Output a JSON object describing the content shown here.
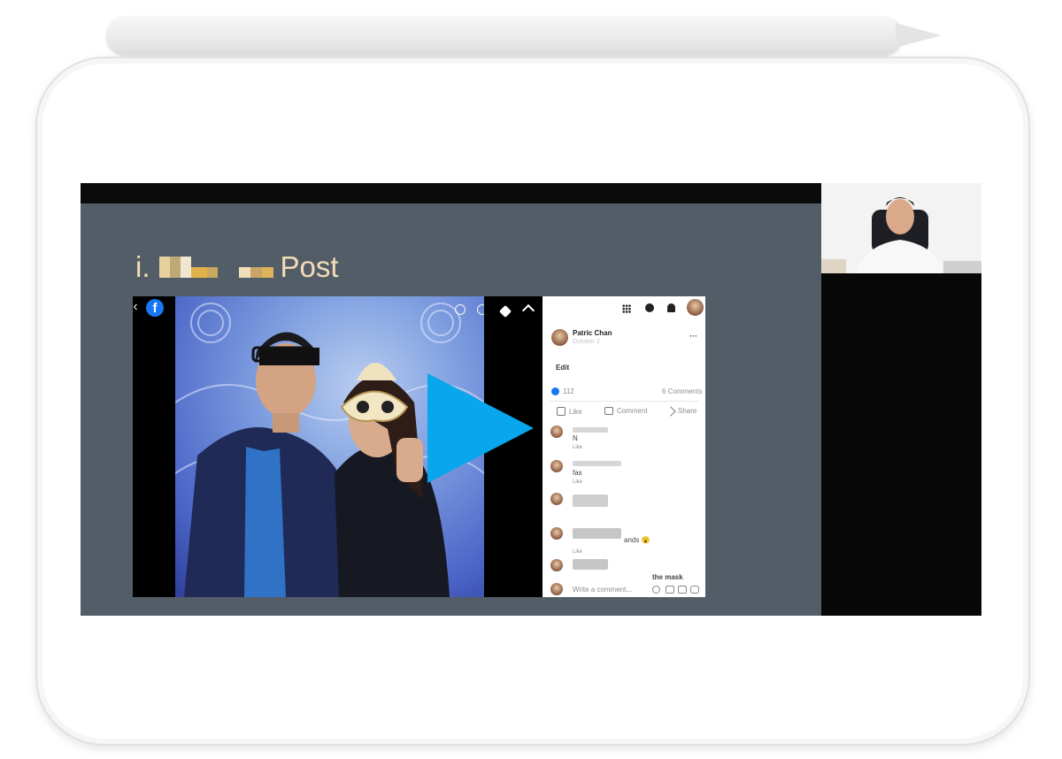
{
  "slide": {
    "title_prefix": "i.",
    "title_word": "Post"
  },
  "post_viewer": {
    "facebook_glyph": "f",
    "back_glyph": "‹",
    "author_name": "Patric Chan",
    "author_date": "October 2",
    "more_glyph": "···",
    "edit_label": "Edit",
    "reaction_count": "112",
    "comments_count": "6 Comments",
    "actions": {
      "like": "Like",
      "comment": "Comment",
      "share": "Share"
    },
    "comments": [
      {
        "reply": "Like",
        "text": "N"
      },
      {
        "reply": "Like",
        "text": "fas"
      },
      {
        "reply": "Like",
        "text": ""
      },
      {
        "reply": "Like",
        "text": "ands 😮"
      },
      {
        "reply": "",
        "text": "the mask"
      }
    ],
    "write_placeholder": "Write a comment..."
  },
  "icons": {
    "zoom_in": "zoom-in-icon",
    "zoom_out": "zoom-out-icon",
    "tag": "tag-icon",
    "fullscreen": "fullscreen-icon",
    "grid": "grid-icon",
    "messenger": "messenger-icon",
    "bell": "bell-icon"
  },
  "colors": {
    "slide_bg": "#535d67",
    "title_color": "#f2ddb8",
    "play_color": "#08a6ec",
    "facebook_blue": "#1877f2"
  }
}
